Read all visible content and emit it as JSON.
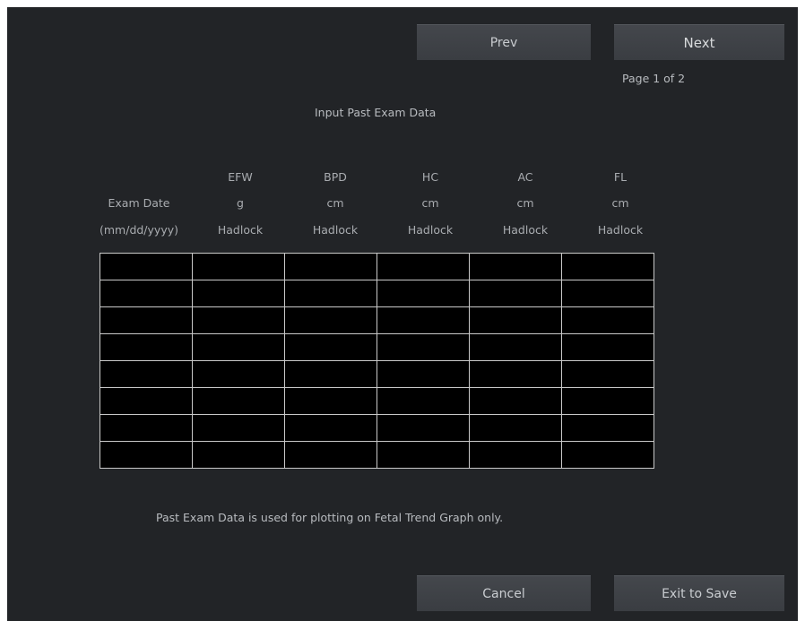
{
  "buttons": {
    "prev": "Prev",
    "next": "Next",
    "cancel": "Cancel",
    "exit_to_save": "Exit to Save"
  },
  "page_indicator": "Page 1 of 2",
  "title": "Input Past Exam Data",
  "exam_date": {
    "label": "Exam Date",
    "format": "(mm/dd/yyyy)"
  },
  "columns": [
    {
      "name": "EFW",
      "unit": "g",
      "method": "Hadlock"
    },
    {
      "name": "BPD",
      "unit": "cm",
      "method": "Hadlock"
    },
    {
      "name": "HC",
      "unit": "cm",
      "method": "Hadlock"
    },
    {
      "name": "AC",
      "unit": "cm",
      "method": "Hadlock"
    },
    {
      "name": "FL",
      "unit": "cm",
      "method": "Hadlock"
    }
  ],
  "rows": [
    [
      "",
      "",
      "",
      "",
      "",
      ""
    ],
    [
      "",
      "",
      "",
      "",
      "",
      ""
    ],
    [
      "",
      "",
      "",
      "",
      "",
      ""
    ],
    [
      "",
      "",
      "",
      "",
      "",
      ""
    ],
    [
      "",
      "",
      "",
      "",
      "",
      ""
    ],
    [
      "",
      "",
      "",
      "",
      "",
      ""
    ],
    [
      "",
      "",
      "",
      "",
      "",
      ""
    ],
    [
      "",
      "",
      "",
      "",
      "",
      ""
    ]
  ],
  "footer_note": "Past Exam Data is used for plotting on Fetal Trend Graph only."
}
